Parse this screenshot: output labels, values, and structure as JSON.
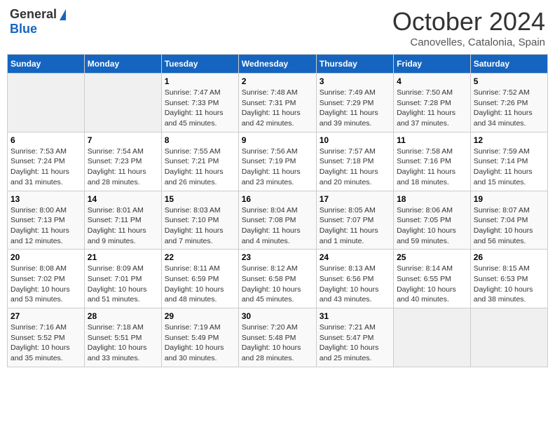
{
  "header": {
    "logo_general": "General",
    "logo_blue": "Blue",
    "month": "October 2024",
    "location": "Canovelles, Catalonia, Spain"
  },
  "days_of_week": [
    "Sunday",
    "Monday",
    "Tuesday",
    "Wednesday",
    "Thursday",
    "Friday",
    "Saturday"
  ],
  "weeks": [
    [
      {
        "day": "",
        "info": ""
      },
      {
        "day": "",
        "info": ""
      },
      {
        "day": "1",
        "info": "Sunrise: 7:47 AM\nSunset: 7:33 PM\nDaylight: 11 hours and 45 minutes."
      },
      {
        "day": "2",
        "info": "Sunrise: 7:48 AM\nSunset: 7:31 PM\nDaylight: 11 hours and 42 minutes."
      },
      {
        "day": "3",
        "info": "Sunrise: 7:49 AM\nSunset: 7:29 PM\nDaylight: 11 hours and 39 minutes."
      },
      {
        "day": "4",
        "info": "Sunrise: 7:50 AM\nSunset: 7:28 PM\nDaylight: 11 hours and 37 minutes."
      },
      {
        "day": "5",
        "info": "Sunrise: 7:52 AM\nSunset: 7:26 PM\nDaylight: 11 hours and 34 minutes."
      }
    ],
    [
      {
        "day": "6",
        "info": "Sunrise: 7:53 AM\nSunset: 7:24 PM\nDaylight: 11 hours and 31 minutes."
      },
      {
        "day": "7",
        "info": "Sunrise: 7:54 AM\nSunset: 7:23 PM\nDaylight: 11 hours and 28 minutes."
      },
      {
        "day": "8",
        "info": "Sunrise: 7:55 AM\nSunset: 7:21 PM\nDaylight: 11 hours and 26 minutes."
      },
      {
        "day": "9",
        "info": "Sunrise: 7:56 AM\nSunset: 7:19 PM\nDaylight: 11 hours and 23 minutes."
      },
      {
        "day": "10",
        "info": "Sunrise: 7:57 AM\nSunset: 7:18 PM\nDaylight: 11 hours and 20 minutes."
      },
      {
        "day": "11",
        "info": "Sunrise: 7:58 AM\nSunset: 7:16 PM\nDaylight: 11 hours and 18 minutes."
      },
      {
        "day": "12",
        "info": "Sunrise: 7:59 AM\nSunset: 7:14 PM\nDaylight: 11 hours and 15 minutes."
      }
    ],
    [
      {
        "day": "13",
        "info": "Sunrise: 8:00 AM\nSunset: 7:13 PM\nDaylight: 11 hours and 12 minutes."
      },
      {
        "day": "14",
        "info": "Sunrise: 8:01 AM\nSunset: 7:11 PM\nDaylight: 11 hours and 9 minutes."
      },
      {
        "day": "15",
        "info": "Sunrise: 8:03 AM\nSunset: 7:10 PM\nDaylight: 11 hours and 7 minutes."
      },
      {
        "day": "16",
        "info": "Sunrise: 8:04 AM\nSunset: 7:08 PM\nDaylight: 11 hours and 4 minutes."
      },
      {
        "day": "17",
        "info": "Sunrise: 8:05 AM\nSunset: 7:07 PM\nDaylight: 11 hours and 1 minute."
      },
      {
        "day": "18",
        "info": "Sunrise: 8:06 AM\nSunset: 7:05 PM\nDaylight: 10 hours and 59 minutes."
      },
      {
        "day": "19",
        "info": "Sunrise: 8:07 AM\nSunset: 7:04 PM\nDaylight: 10 hours and 56 minutes."
      }
    ],
    [
      {
        "day": "20",
        "info": "Sunrise: 8:08 AM\nSunset: 7:02 PM\nDaylight: 10 hours and 53 minutes."
      },
      {
        "day": "21",
        "info": "Sunrise: 8:09 AM\nSunset: 7:01 PM\nDaylight: 10 hours and 51 minutes."
      },
      {
        "day": "22",
        "info": "Sunrise: 8:11 AM\nSunset: 6:59 PM\nDaylight: 10 hours and 48 minutes."
      },
      {
        "day": "23",
        "info": "Sunrise: 8:12 AM\nSunset: 6:58 PM\nDaylight: 10 hours and 45 minutes."
      },
      {
        "day": "24",
        "info": "Sunrise: 8:13 AM\nSunset: 6:56 PM\nDaylight: 10 hours and 43 minutes."
      },
      {
        "day": "25",
        "info": "Sunrise: 8:14 AM\nSunset: 6:55 PM\nDaylight: 10 hours and 40 minutes."
      },
      {
        "day": "26",
        "info": "Sunrise: 8:15 AM\nSunset: 6:53 PM\nDaylight: 10 hours and 38 minutes."
      }
    ],
    [
      {
        "day": "27",
        "info": "Sunrise: 7:16 AM\nSunset: 5:52 PM\nDaylight: 10 hours and 35 minutes."
      },
      {
        "day": "28",
        "info": "Sunrise: 7:18 AM\nSunset: 5:51 PM\nDaylight: 10 hours and 33 minutes."
      },
      {
        "day": "29",
        "info": "Sunrise: 7:19 AM\nSunset: 5:49 PM\nDaylight: 10 hours and 30 minutes."
      },
      {
        "day": "30",
        "info": "Sunrise: 7:20 AM\nSunset: 5:48 PM\nDaylight: 10 hours and 28 minutes."
      },
      {
        "day": "31",
        "info": "Sunrise: 7:21 AM\nSunset: 5:47 PM\nDaylight: 10 hours and 25 minutes."
      },
      {
        "day": "",
        "info": ""
      },
      {
        "day": "",
        "info": ""
      }
    ]
  ]
}
